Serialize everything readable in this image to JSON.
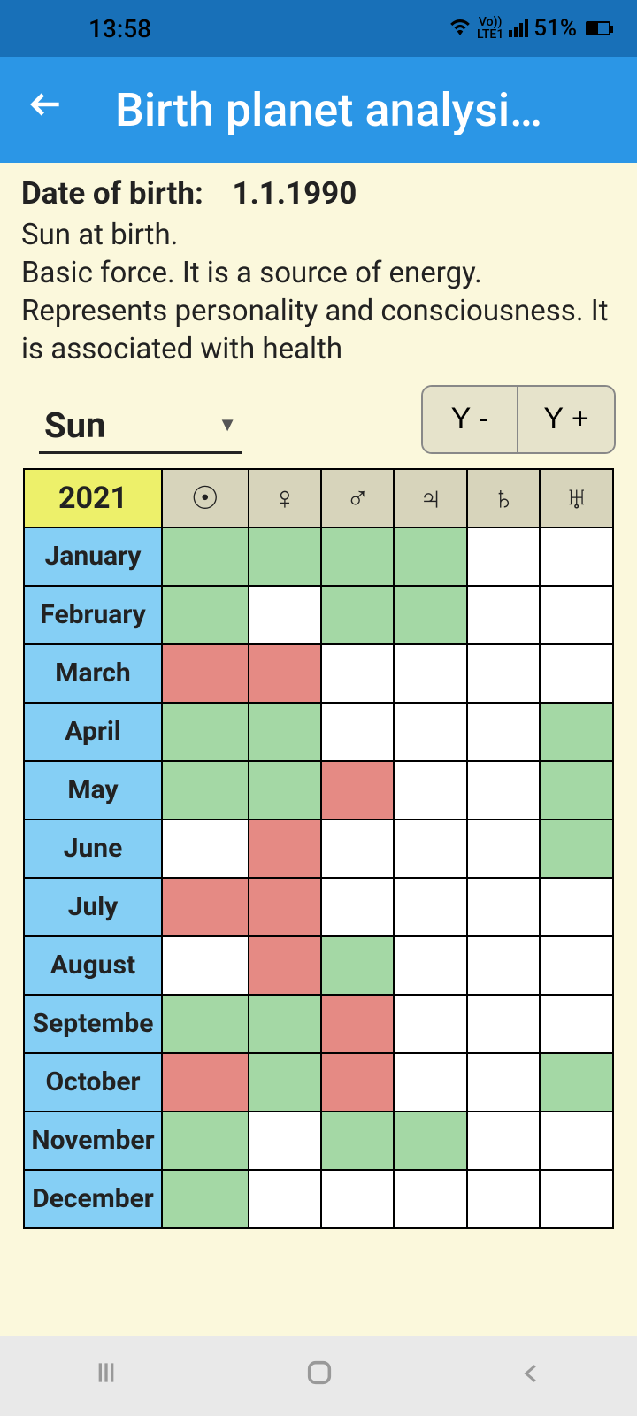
{
  "status": {
    "time": "13:58",
    "battery": "51%",
    "lte": "LTE1",
    "vo": "Vo))"
  },
  "app": {
    "title": "Birth planet analysi…"
  },
  "dob": {
    "label": "Date of birth:",
    "value": "1.1.1990"
  },
  "description": "Sun at birth.\nBasic force. It is a source of energy. Represents personality and consciousness. It is associated with health",
  "planet_select": {
    "value": "Sun"
  },
  "year_buttons": {
    "prev": "Y -",
    "next": "Y +"
  },
  "table": {
    "year": "2021",
    "planets": [
      "☉",
      "♀",
      "♂",
      "♃",
      "♄",
      "♅"
    ],
    "months": [
      "January",
      "February",
      "March",
      "April",
      "May",
      "June",
      "July",
      "August",
      "Septembe",
      "October",
      "November",
      "December"
    ],
    "cells": [
      [
        "g",
        "g",
        "g",
        "g",
        "w",
        "w"
      ],
      [
        "g",
        "w",
        "g",
        "g",
        "w",
        "w"
      ],
      [
        "r",
        "r",
        "w",
        "w",
        "w",
        "w"
      ],
      [
        "g",
        "g",
        "w",
        "w",
        "w",
        "g"
      ],
      [
        "g",
        "g",
        "r",
        "w",
        "w",
        "g"
      ],
      [
        "w",
        "r",
        "w",
        "w",
        "w",
        "g"
      ],
      [
        "r",
        "r",
        "w",
        "w",
        "w",
        "w"
      ],
      [
        "w",
        "r",
        "g",
        "w",
        "w",
        "w"
      ],
      [
        "g",
        "g",
        "r",
        "w",
        "w",
        "w"
      ],
      [
        "r",
        "g",
        "r",
        "w",
        "w",
        "g"
      ],
      [
        "g",
        "w",
        "g",
        "g",
        "w",
        "w"
      ],
      [
        "g",
        "w",
        "w",
        "w",
        "w",
        "w"
      ]
    ]
  }
}
